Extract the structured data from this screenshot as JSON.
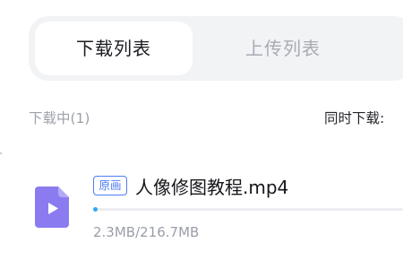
{
  "tabs": {
    "download_label": "下载列表",
    "upload_label": "上传列表",
    "active": "download"
  },
  "downloading": {
    "section_title": "下载中(1)",
    "concurrent_label": "同时下载:"
  },
  "items": [
    {
      "badge": "原画",
      "file_name": "人像修图教程.mp4",
      "size_text": "2.3MB/216.7MB",
      "progress": 0.0106,
      "file_type": "video",
      "icon": "video-file-icon"
    }
  ],
  "colors": {
    "accent": "#4d7df5",
    "progress": "#2eaaf0",
    "file_icon": "#8a7cf0",
    "tab_background": "#f2f3f5",
    "muted_text": "#9da1aa"
  }
}
